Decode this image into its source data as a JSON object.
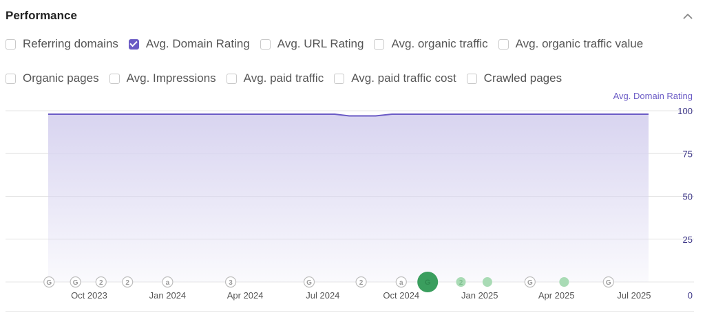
{
  "panel": {
    "title": "Performance",
    "collapse_icon": "chevron-up-icon"
  },
  "metrics": [
    {
      "label": "Referring domains",
      "checked": false
    },
    {
      "label": "Avg. Domain Rating",
      "checked": true
    },
    {
      "label": "Avg. URL Rating",
      "checked": false
    },
    {
      "label": "Avg. organic traffic",
      "checked": false
    },
    {
      "label": "Avg. organic traffic value",
      "checked": false
    },
    {
      "label": "Organic pages",
      "checked": false
    },
    {
      "label": "Avg. Impressions",
      "checked": false
    },
    {
      "label": "Avg. paid traffic",
      "checked": false
    },
    {
      "label": "Avg. paid traffic cost",
      "checked": false
    },
    {
      "label": "Crawled pages",
      "checked": false
    }
  ],
  "colors": {
    "series": "#6a5ac5",
    "area_top": "#d8d4f0",
    "grid": "#e4e4e4",
    "marker_gray": "#bdbdbd",
    "marker_green": "#3a9e5e",
    "marker_green_light": "#a9dbb5"
  },
  "chart_data": {
    "type": "area",
    "title": "",
    "series_label": "Avg. Domain Rating",
    "series": [
      {
        "name": "Avg. Domain Rating",
        "points": [
          [
            "2023-08-14",
            98
          ],
          [
            "2023-10-01",
            98
          ],
          [
            "2024-01-01",
            98
          ],
          [
            "2024-04-01",
            98
          ],
          [
            "2024-07-01",
            98
          ],
          [
            "2024-07-15",
            98
          ],
          [
            "2024-08-01",
            97
          ],
          [
            "2024-09-01",
            97
          ],
          [
            "2024-09-20",
            98
          ],
          [
            "2024-10-15",
            98
          ],
          [
            "2025-01-01",
            98
          ],
          [
            "2025-04-01",
            98
          ],
          [
            "2025-07-18",
            98
          ]
        ]
      }
    ],
    "x_range": [
      "2023-08-14",
      "2025-07-18"
    ],
    "x_ticks": [
      {
        "date": "2023-10-01",
        "label": "Oct 2023"
      },
      {
        "date": "2024-01-01",
        "label": "Jan 2024"
      },
      {
        "date": "2024-04-01",
        "label": "Apr 2024"
      },
      {
        "date": "2024-07-01",
        "label": "Jul 2024"
      },
      {
        "date": "2024-10-01",
        "label": "Oct 2024"
      },
      {
        "date": "2025-01-01",
        "label": "Jan 2025"
      },
      {
        "date": "2025-04-01",
        "label": "Apr 2025"
      },
      {
        "date": "2025-07-01",
        "label": "Jul 2025"
      }
    ],
    "ylim": [
      0,
      100
    ],
    "y_ticks": [
      "0",
      "25",
      "50",
      "75",
      "100"
    ],
    "grid": true,
    "axis_position": "right",
    "markers": [
      {
        "date": "2023-08-15",
        "label": "G",
        "style": "gray"
      },
      {
        "date": "2023-09-15",
        "label": "G",
        "style": "gray"
      },
      {
        "date": "2023-10-15",
        "label": "2",
        "style": "gray"
      },
      {
        "date": "2023-11-15",
        "label": "2",
        "style": "gray"
      },
      {
        "date": "2024-01-01",
        "label": "a",
        "style": "gray"
      },
      {
        "date": "2024-03-15",
        "label": "3",
        "style": "gray"
      },
      {
        "date": "2024-06-15",
        "label": "G",
        "style": "gray"
      },
      {
        "date": "2024-08-15",
        "label": "2",
        "style": "gray"
      },
      {
        "date": "2024-10-01",
        "label": "a",
        "style": "gray"
      },
      {
        "date": "2024-11-01",
        "label": "G",
        "style": "green-large"
      },
      {
        "date": "2024-12-10",
        "label": "2",
        "style": "green-light"
      },
      {
        "date": "2025-01-10",
        "label": "",
        "style": "green-light"
      },
      {
        "date": "2025-03-01",
        "label": "G",
        "style": "gray"
      },
      {
        "date": "2025-04-10",
        "label": "",
        "style": "green-light"
      },
      {
        "date": "2025-06-01",
        "label": "G",
        "style": "gray"
      }
    ]
  }
}
